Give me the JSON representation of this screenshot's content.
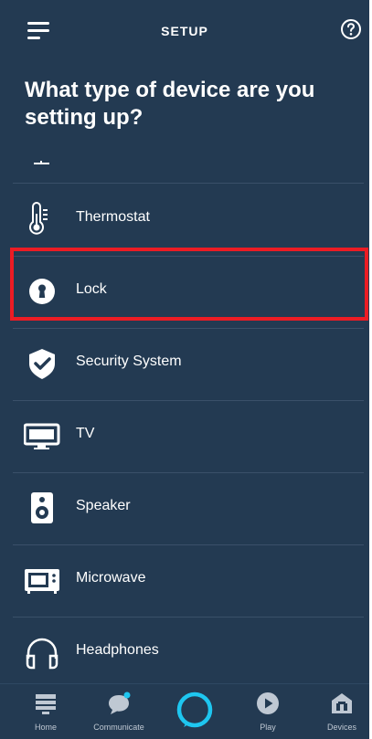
{
  "header": {
    "title": "SETUP"
  },
  "heading": "What type of device are you setting up?",
  "devices": [
    {
      "label": "Thermostat",
      "icon": "thermostat-icon"
    },
    {
      "label": "Lock",
      "icon": "lock-icon"
    },
    {
      "label": "Security System",
      "icon": "security-shield-icon"
    },
    {
      "label": "TV",
      "icon": "tv-icon"
    },
    {
      "label": "Speaker",
      "icon": "speaker-icon"
    },
    {
      "label": "Microwave",
      "icon": "microwave-icon"
    },
    {
      "label": "Headphones",
      "icon": "headphones-icon"
    }
  ],
  "bottom_nav": {
    "home": "Home",
    "communicate": "Communicate",
    "play": "Play",
    "devices": "Devices"
  },
  "colors": {
    "background": "#233a52",
    "highlight": "#ec1c24",
    "alexa_ring": "#1ec6f0",
    "notification_dot": "#1ec6f0"
  }
}
